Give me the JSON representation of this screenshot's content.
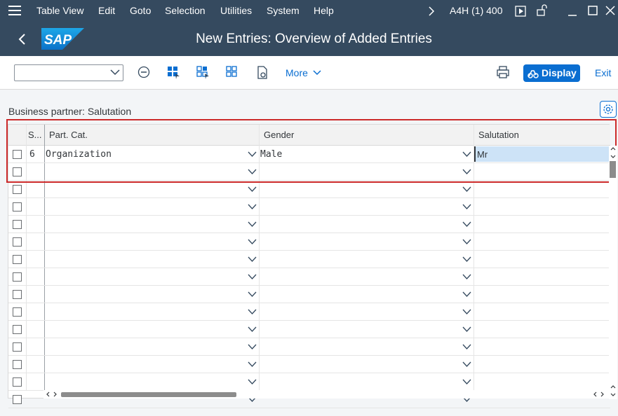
{
  "menubar": {
    "items": [
      "Table View",
      "Edit",
      "Goto",
      "Selection",
      "Utilities",
      "System",
      "Help"
    ],
    "system_info": "A4H (1) 400"
  },
  "titlebar": {
    "title": "New Entries: Overview of Added Entries",
    "logo_text": "SAP"
  },
  "toolbar": {
    "more_label": "More",
    "display_label": "Display",
    "exit_label": "Exit"
  },
  "section": {
    "title": "Business partner: Salutation"
  },
  "table": {
    "columns": [
      "S...",
      "Part. Cat.",
      "Gender",
      "Salutation"
    ],
    "rows": [
      {
        "seq": "6",
        "part_cat": "Organization",
        "gender": "Male",
        "salutation": "Mr"
      }
    ],
    "empty_row_count": 14
  },
  "colors": {
    "shell": "#354a5f",
    "accent": "#0a6ed1",
    "highlight": "#cc2a2a",
    "selected_cell": "#cde3f7"
  }
}
